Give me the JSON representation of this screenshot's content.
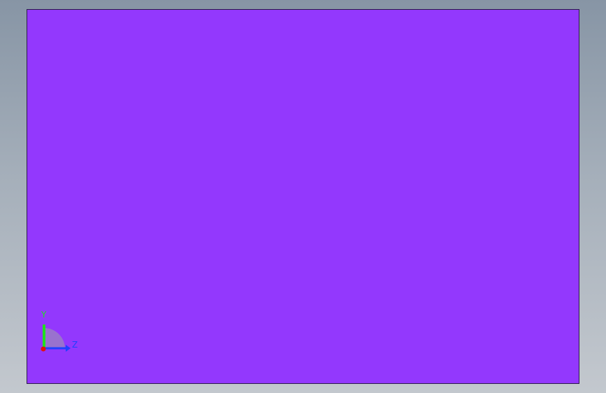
{
  "viewport": {
    "background_top": "#8795a5",
    "background_bottom": "#c3c8ce"
  },
  "model": {
    "face_color": "#9338fd"
  },
  "triad": {
    "y_label": "Y",
    "z_label": "Z",
    "y_color": "#20e020",
    "z_color": "#2040ff",
    "x_color": "#e01010",
    "arc_color": "#9a7cc6"
  }
}
